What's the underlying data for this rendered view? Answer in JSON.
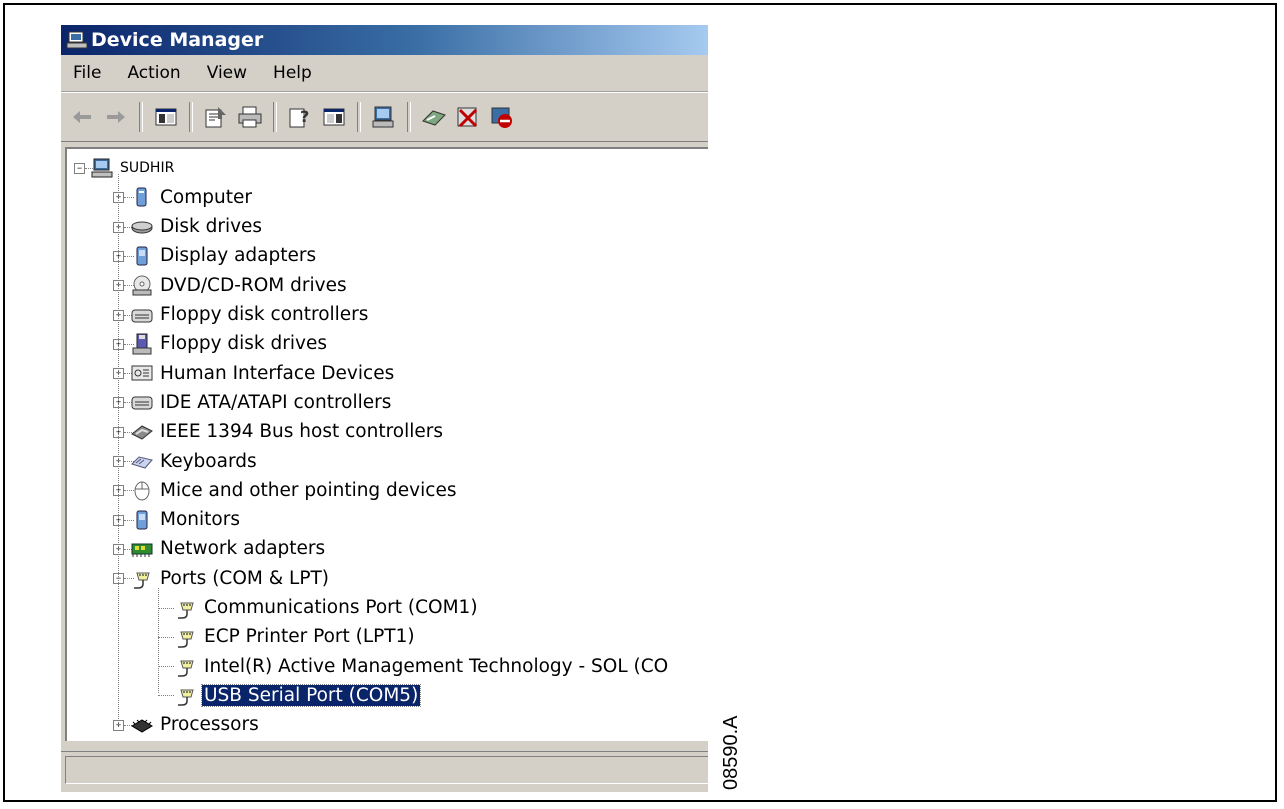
{
  "window": {
    "title": "Device Manager"
  },
  "menu": [
    "File",
    "Action",
    "View",
    "Help"
  ],
  "toolbar": [
    "back-icon",
    "forward-icon",
    "sep",
    "show-hide-tree-icon",
    "sep",
    "properties-icon",
    "print-icon",
    "sep",
    "help-icon",
    "export-list-icon",
    "sep",
    "scan-hardware-icon",
    "sep",
    "update-driver-icon",
    "uninstall-icon",
    "disable-icon"
  ],
  "tree": {
    "root": "SUDHIR",
    "categories": [
      {
        "label": "Computer",
        "icon": "computer-icon"
      },
      {
        "label": "Disk drives",
        "icon": "disk-drive-icon"
      },
      {
        "label": "Display adapters",
        "icon": "display-adapter-icon"
      },
      {
        "label": "DVD/CD-ROM drives",
        "icon": "dvd-drive-icon"
      },
      {
        "label": "Floppy disk controllers",
        "icon": "floppy-controller-icon"
      },
      {
        "label": "Floppy disk drives",
        "icon": "floppy-drive-icon"
      },
      {
        "label": "Human Interface Devices",
        "icon": "hid-icon"
      },
      {
        "label": "IDE ATA/ATAPI controllers",
        "icon": "ide-controller-icon"
      },
      {
        "label": "IEEE 1394 Bus host controllers",
        "icon": "ieee1394-icon"
      },
      {
        "label": "Keyboards",
        "icon": "keyboard-icon"
      },
      {
        "label": "Mice and other pointing devices",
        "icon": "mouse-icon"
      },
      {
        "label": "Monitors",
        "icon": "monitor-icon"
      },
      {
        "label": "Network adapters",
        "icon": "network-adapter-icon"
      },
      {
        "label": "Ports (COM & LPT)",
        "icon": "port-icon",
        "expanded": true
      },
      {
        "label": "Processors",
        "icon": "processor-icon"
      }
    ],
    "ports": [
      "Communications Port (COM1)",
      "ECP Printer Port (LPT1)",
      "Intel(R) Active Management Technology - SOL (CO",
      "USB Serial Port (COM5)"
    ],
    "selected_port": "USB Serial Port (COM5)"
  },
  "figure_label": "08590.A"
}
